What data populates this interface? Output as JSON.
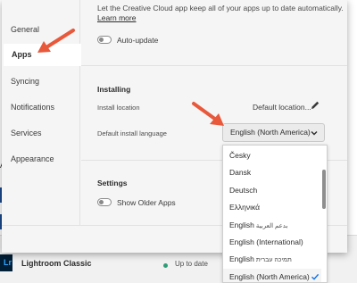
{
  "background": {
    "app_name": "Lightroom Classic",
    "app_tile_letters": "Lr",
    "status": "Up to date",
    "left_letter": "A"
  },
  "sidebar": {
    "items": [
      {
        "label": "General"
      },
      {
        "label": "Apps"
      },
      {
        "label": "Syncing"
      },
      {
        "label": "Notifications"
      },
      {
        "label": "Services"
      },
      {
        "label": "Appearance"
      }
    ],
    "selected": "Apps"
  },
  "content": {
    "description": "Let the Creative Cloud app keep all of your apps up to date automatically.",
    "learn_more": "Learn more",
    "auto_update_label": "Auto-update",
    "installing": {
      "title": "Installing",
      "install_location_label": "Install location",
      "install_location_value": "Default location...",
      "language_label": "Default install language",
      "language_value": "English (North America)"
    },
    "settings": {
      "title": "Settings",
      "show_older_label": "Show Older Apps"
    }
  },
  "dropdown": {
    "options": [
      {
        "label": "Česky"
      },
      {
        "label": "Dansk"
      },
      {
        "label": "Deutsch"
      },
      {
        "label": "Ελληνικά"
      },
      {
        "label": "English",
        "sub": "بدعم العربية"
      },
      {
        "label": "English (International)"
      },
      {
        "label": "English",
        "sub": "תמיכה עברית"
      },
      {
        "label": "English (North America)",
        "checked": true
      }
    ]
  },
  "colors": {
    "annotation_arrow": "#e8583b",
    "brand_blue": "#1473e6",
    "status_green": "#2d9d78"
  }
}
